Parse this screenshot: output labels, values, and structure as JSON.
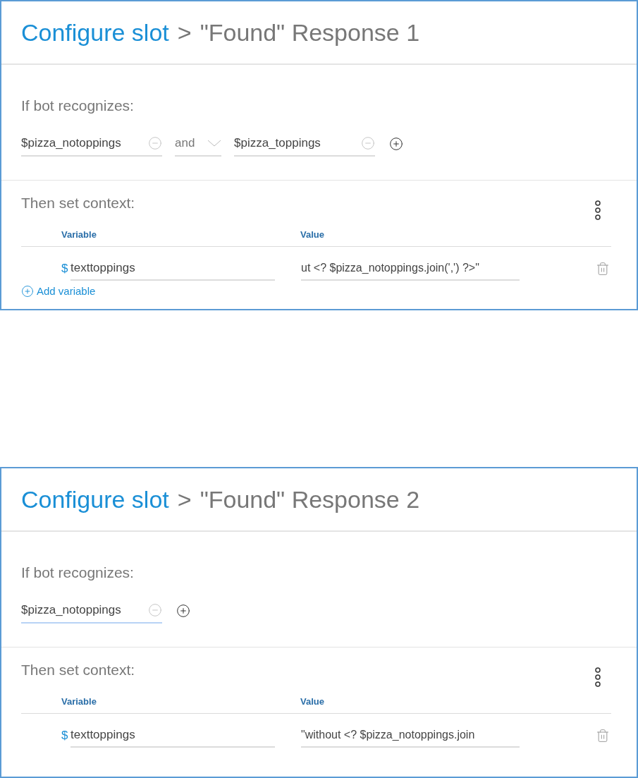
{
  "panels": [
    {
      "breadcrumb": {
        "link": "Configure slot",
        "separator": ">",
        "current": "\"Found\" Response 1"
      },
      "condition": {
        "label": "If bot recognizes:",
        "items": [
          {
            "kind": "entity",
            "value": "$pizza_notoppings",
            "focused": false
          },
          {
            "kind": "operator",
            "value": "and"
          },
          {
            "kind": "entity",
            "value": "$pizza_toppings",
            "focused": false
          }
        ]
      },
      "context": {
        "label": "Then set context:",
        "columns": [
          "Variable",
          "Value"
        ],
        "rows": [
          {
            "prefix": "$",
            "variable": "texttoppings",
            "value": "ut <? $pizza_notoppings.join(',') ?>\""
          }
        ],
        "add_label": "Add variable"
      }
    },
    {
      "breadcrumb": {
        "link": "Configure slot",
        "separator": ">",
        "current": "\"Found\" Response 2"
      },
      "condition": {
        "label": "If bot recognizes:",
        "items": [
          {
            "kind": "entity",
            "value": "$pizza_notoppings",
            "focused": true
          }
        ]
      },
      "context": {
        "label": "Then set context:",
        "columns": [
          "Variable",
          "Value"
        ],
        "rows": [
          {
            "prefix": "$",
            "variable": "texttoppings",
            "value": "\"without <? $pizza_notoppings.join"
          }
        ]
      }
    }
  ]
}
